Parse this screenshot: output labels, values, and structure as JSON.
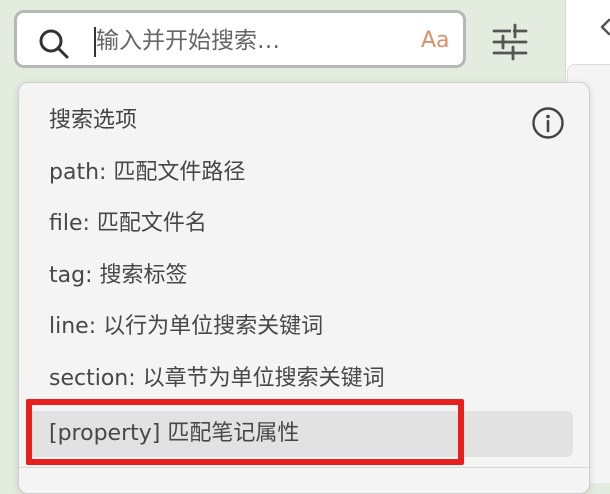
{
  "search": {
    "placeholder": "输入并开始搜索…",
    "match_case_label": "Aa"
  },
  "options_panel": {
    "title": "搜索选项",
    "items": [
      {
        "label": "path: 匹配文件路径"
      },
      {
        "label": "file: 匹配文件名"
      },
      {
        "label": "tag: 搜索标签"
      },
      {
        "label": "line: 以行为单位搜索关键词"
      },
      {
        "label": "section: 以章节为单位搜索关键词"
      },
      {
        "label": "[property] 匹配笔记属性"
      }
    ],
    "highlighted_index": 5
  },
  "icons": {
    "search": "search-icon",
    "settings": "sliders-icon",
    "info": "info-icon",
    "pane_arrow": "chevron-left-icon"
  },
  "colors": {
    "background": "#e3ecdf",
    "match_case_accent": "#d9906a",
    "annotation": "#e8201d",
    "highlight_row": "#e2e2e2"
  }
}
